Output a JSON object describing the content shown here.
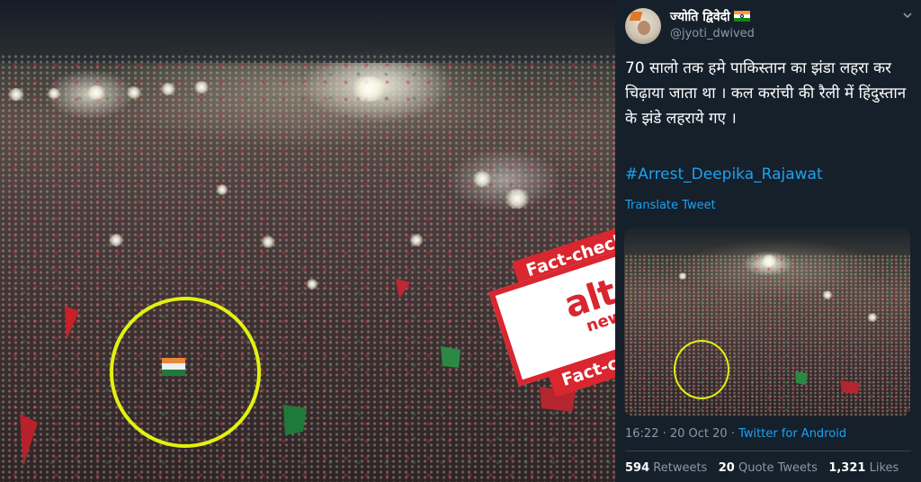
{
  "tweet": {
    "user_name": "ज्योति द्विवेदी",
    "handle": "@jyoti_dwived",
    "text": "70 सालो तक हमे पाकिस्तान का झंडा लहरा कर चिढ़ाया जाता था । कल करांची की रैली में हिंदुस्तान के झंडे लहराये गए ।",
    "hashtag": "#Arrest_Deepika_Rajawat",
    "translate_label": "Translate Tweet",
    "time": "16:22 · 20 Oct 20 · ",
    "source": "Twitter for Android",
    "retweets_count": "594",
    "retweets_label": "Retweets",
    "quote_count": "20",
    "quote_label": "Quote Tweets",
    "likes_count": "1,321",
    "likes_label": "Likes"
  },
  "stamp": {
    "top_label": "Fact-check",
    "logo_main": "alt",
    "logo_sub": "news",
    "bottom_label": "Fact-check"
  },
  "colors": {
    "highlight_ring": "#e1f20f",
    "stamp_red": "#d9262f",
    "twitter_blue": "#1da1f2",
    "background": "#15202b"
  },
  "icons": [
    "chevron-down-icon",
    "india-flag-icon"
  ]
}
